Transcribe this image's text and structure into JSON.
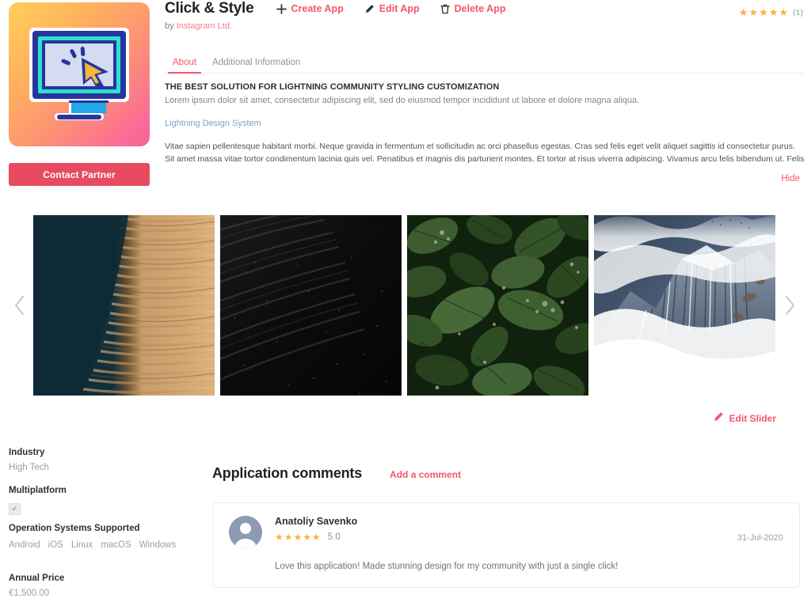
{
  "header": {
    "app_title": "Click & Style",
    "by_prefix": "by",
    "publisher": "Instagram Ltd.",
    "actions": [
      {
        "label": "Create App",
        "icon": "plus-icon"
      },
      {
        "label": "Edit App",
        "icon": "pencil-icon"
      },
      {
        "label": "Delete App",
        "icon": "trash-icon"
      }
    ],
    "rating": {
      "stars": "★★★★★",
      "count_label": "(1)",
      "star_color": "#fbb040"
    }
  },
  "sidebar": {
    "contact_button": "Contact Partner",
    "fields": [
      {
        "label": "Industry",
        "value": "High Tech"
      },
      {
        "label": "Multiplatform",
        "value": "",
        "type": "checkbox",
        "checked_glyph": "✔"
      },
      {
        "label": "Operation Systems Supported",
        "value": ""
      },
      {
        "label": "Annual Price",
        "value": "€1,500.00"
      }
    ],
    "os_supported": [
      "Android",
      "iOS",
      "Linux",
      "macOS",
      "Windows"
    ]
  },
  "tabs": [
    {
      "label": "About",
      "active": true
    },
    {
      "label": "Additional Information",
      "active": false
    }
  ],
  "about": {
    "heading": "THE BEST SOLUTION FOR LIGHTNING COMMUNITY STYLING CUSTOMIZATION",
    "subheading": "Lorem ipsum dolor sit amet, consectetur adipiscing elit, sed do eiusmod tempor incididunt ut labore et dolore magna aliqua.",
    "link": "Lightning Design System",
    "paragraph": "Vitae sapien pellentesque habitant morbi. Neque gravida in fermentum et sollicitudin ac orci phasellus egestas. Cras sed felis eget velit aliquet sagittis id consectetur purus. Sit amet massa vitae tortor condimentum lacinia quis vel. Penatibus et magnis dis parturient montes. Et tortor at risus viverra adipiscing. Vivamus arcu felis bibendum ut. Felis donec et odio pellentesque diam volutpat commodo sed egestas. Quam id leo in vitae turpis massa. Tempus urna et pharetra pharetra massa massa ultricies mi. Elit sed vulputate mi sit amet mauris commodo quis imperdiet. Dolor sed viverra ipsum nunc.",
    "hide_label": "Hide"
  },
  "carousel": {
    "prev_icon": "chevron-left-icon",
    "next_icon": "chevron-right-icon",
    "edit_label": "Edit Slider",
    "edit_icon": "pencil-icon",
    "slides": [
      {
        "name": "sand-dune-photo"
      },
      {
        "name": "black-sand-photo"
      },
      {
        "name": "green-leaves-photo"
      },
      {
        "name": "snowy-mountain-photo"
      }
    ]
  },
  "comments": {
    "title": "Application comments",
    "add_label": "Add a comment",
    "items": [
      {
        "author": "Anatoliy Savenko",
        "stars": "★★★★★",
        "score": "5.0",
        "date": "31-Jul-2020",
        "text": "Love this application! Made stunning design for my community with just a single click!"
      }
    ]
  },
  "theme": {
    "accent": "#f4556c",
    "star": "#fbb040",
    "muted": "#9aa0a6"
  }
}
